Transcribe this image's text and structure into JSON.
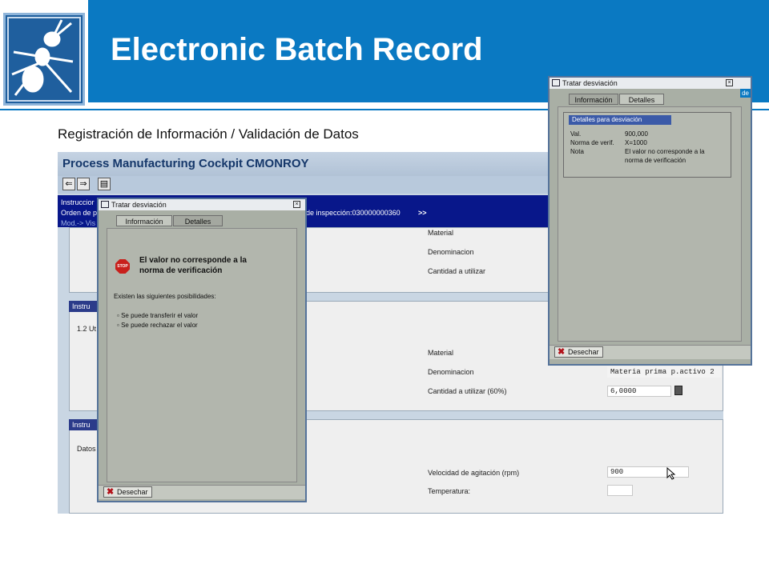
{
  "slide": {
    "title": "Electronic Batch Record",
    "subtitle": "Registración de Información / Validación de Datos",
    "colors": {
      "header": "#0a79c2",
      "logo_bg": "#1f5f9e"
    }
  },
  "screen": {
    "app_title": "Process Manufacturing Cockpit CMONROY",
    "toolbar": {
      "back_icon": "arrow-left-icon",
      "forward_icon": "arrow-right-icon",
      "page_icon": "page-icon",
      "back": "⇐",
      "forward": "⇒",
      "page": "▤"
    },
    "header_band": {
      "line1": "Instruccior",
      "line2": "Orden de p",
      "line3": "Mod.-> Vis",
      "inspection": "de inspección:030000000360",
      "more": ">>"
    },
    "section1": {
      "material_label": "Material",
      "denominacion_label": "Denominacion",
      "cantidad_label": "Cantidad a utilizar"
    },
    "section2": {
      "header": "Instru",
      "step": "1.2 Ut",
      "material_label": "Material",
      "denominacion_label": "Denominacion",
      "denominacion_value": "Materia prima p.activo 2",
      "cantidad_label": "Cantidad a utilizar (60%)",
      "cantidad_value": "6,0000"
    },
    "section3": {
      "header": "Instru",
      "datos": "Datos",
      "velocidad_label": "Velocidad de agitación (rpm)",
      "velocidad_value": "900",
      "temperatura_label": "Temperatura:"
    }
  },
  "dialog_info": {
    "title": "Tratar desviación",
    "tabs": [
      "Información",
      "Detalles"
    ],
    "stop_label": "STOP",
    "message_line1": "El valor no corresponde a la",
    "message_line2": "norma de verificación",
    "intro": "Existen las siguientes posibilidades:",
    "options": [
      "Se puede transferir el valor",
      "Se puede rechazar el valor"
    ],
    "close_button": "Desechar"
  },
  "dialog_details": {
    "title": "Tratar desviación",
    "tabs": [
      "Información",
      "Detalles"
    ],
    "group_title": "Detalles para desviación",
    "rows": [
      {
        "label": "Val.",
        "value": "900,000"
      },
      {
        "label": "Norma de verif.",
        "value": "X=1000"
      },
      {
        "label": "Nota",
        "value": "El valor no corresponde a la",
        "value2": "norma de verificación"
      }
    ],
    "close_button": "Desechar",
    "edge_text": "de"
  }
}
